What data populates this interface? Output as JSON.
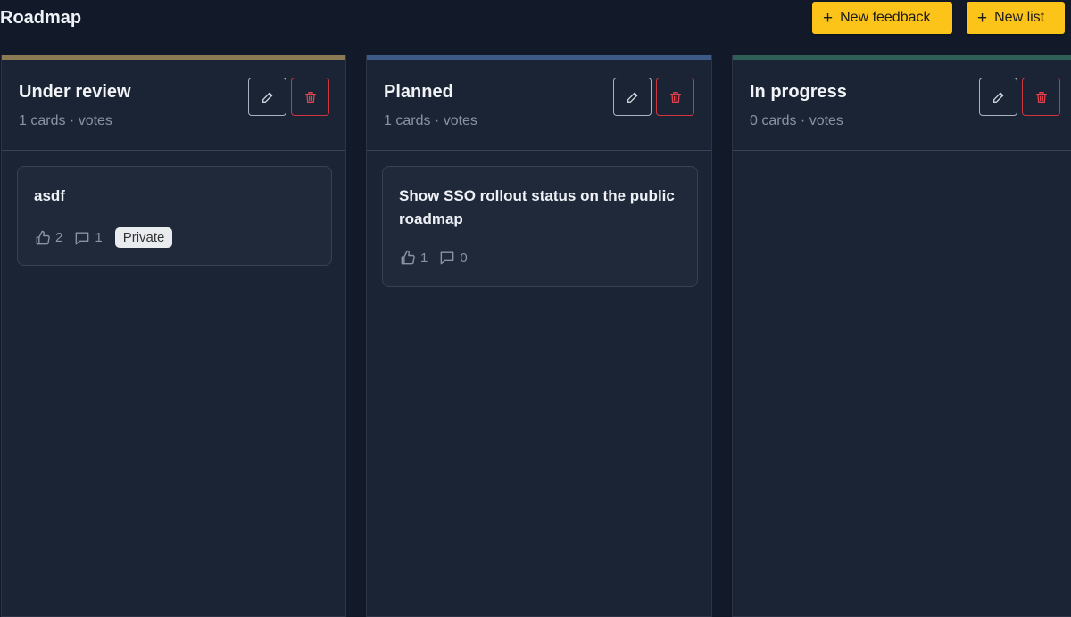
{
  "page": {
    "title": "Roadmap"
  },
  "toolbar": {
    "new_feedback_label": "New feedback",
    "new_list_label": "New list"
  },
  "colors": {
    "accent": "#fcc419",
    "under_review_stripe": "#8c7a55",
    "planned_stripe": "#3e5a86",
    "in_progress_stripe": "#2f5e55",
    "danger": "#d0343f"
  },
  "columns": [
    {
      "title": "Under review",
      "meta": "1 cards · votes",
      "cards": [
        {
          "title": "asdf",
          "votes": "2",
          "comments": "1",
          "badge": "Private"
        }
      ]
    },
    {
      "title": "Planned",
      "meta": "1 cards · votes",
      "cards": [
        {
          "title": "Show SSO rollout status on the public roadmap",
          "votes": "1",
          "comments": "0"
        }
      ]
    },
    {
      "title": "In progress",
      "meta": "0 cards · votes",
      "cards": []
    }
  ],
  "icons": {
    "add": "plus-icon",
    "edit": "pencil-icon",
    "delete": "trash-icon",
    "votes": "thumbs-up-icon",
    "comments": "comment-icon"
  }
}
